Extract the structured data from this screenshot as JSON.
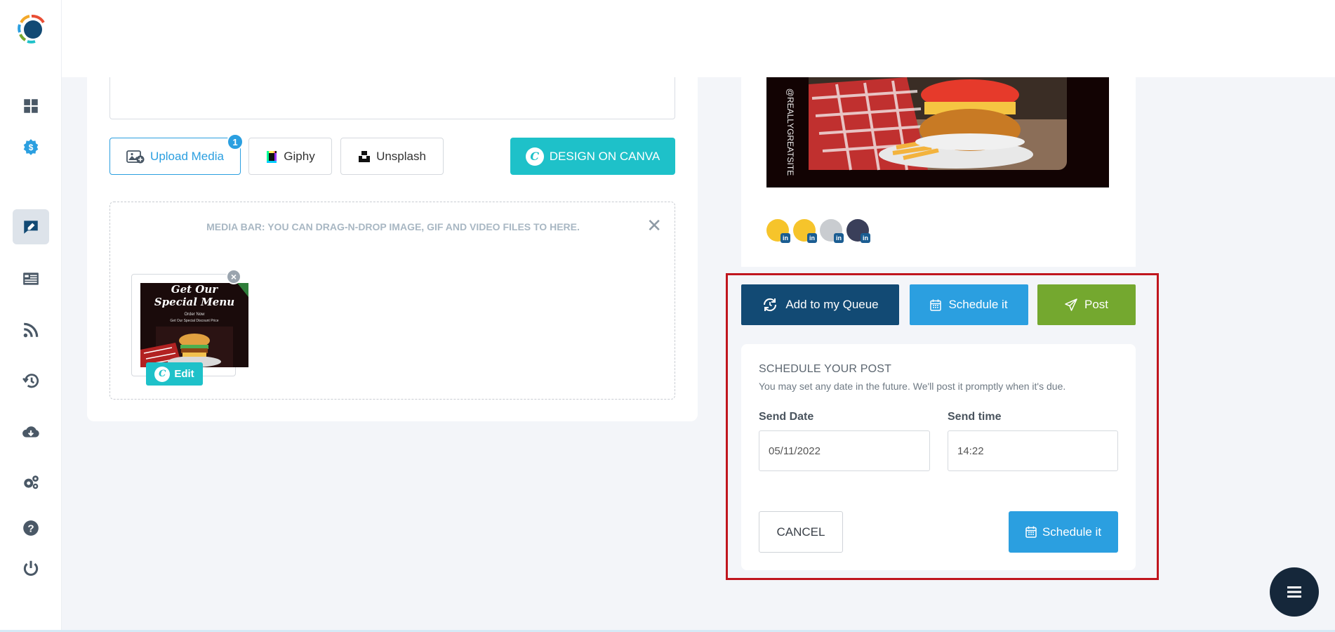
{
  "sidebar": {
    "items": [
      {
        "icon": "dashboard-icon"
      },
      {
        "icon": "billing-icon"
      },
      {
        "icon": "compose-icon",
        "active": true
      },
      {
        "icon": "posts-list-icon"
      },
      {
        "icon": "rss-feed-icon"
      },
      {
        "icon": "history-icon"
      },
      {
        "icon": "cloud-download-icon"
      },
      {
        "icon": "settings-icon"
      },
      {
        "icon": "help-icon"
      },
      {
        "icon": "power-icon"
      }
    ]
  },
  "composer": {
    "upload_label": "Upload Media",
    "upload_badge": "1",
    "giphy_label": "Giphy",
    "unsplash_label": "Unsplash",
    "canva_label": "DESIGN ON CANVA",
    "media_bar_text": "MEDIA BAR: YOU CAN DRAG-N-DROP IMAGE, GIF AND VIDEO FILES TO HERE.",
    "close_glyph": "✕",
    "thumb": {
      "line1": "Get Our",
      "line2": "Special Menu",
      "line3": "Order Now",
      "line4": "Get Our Special Discount Price",
      "edit_label": "Edit"
    }
  },
  "preview": {
    "watermark": "@REALLYGREATSITE",
    "avatar_badge": "in"
  },
  "actions": {
    "queue_label": "Add to my Queue",
    "schedule_label": "Schedule it",
    "post_label": "Post"
  },
  "schedule": {
    "title": "SCHEDULE YOUR POST",
    "description": "You may set any date in the future. We'll post it promptly when it's due.",
    "send_date_label": "Send Date",
    "send_date_value": "05/11/2022",
    "send_time_label": "Send time",
    "send_time_value": "14:22",
    "cancel_label": "CANCEL",
    "schedule_label": "Schedule it"
  },
  "colors": {
    "accent_blue": "#2b9fe0",
    "navy": "#124a74",
    "green": "#74a82f",
    "canva_teal": "#1ec1c9",
    "highlight_red": "#c0161e"
  }
}
